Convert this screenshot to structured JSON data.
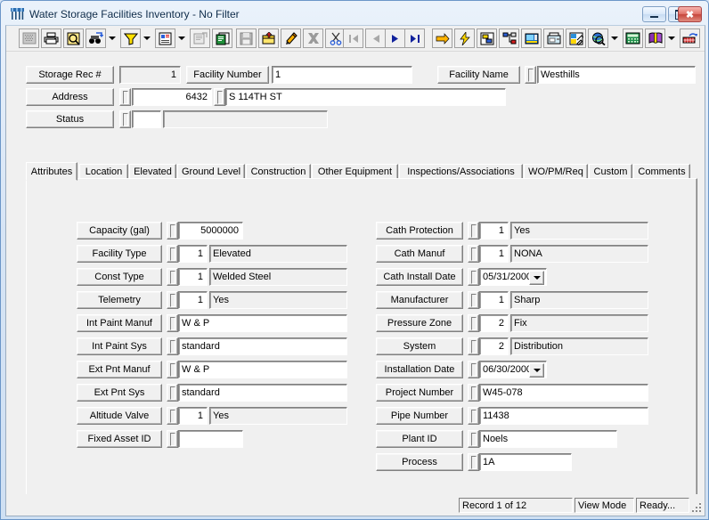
{
  "window": {
    "title": "Water Storage Facilities Inventory - No Filter",
    "icon": "water-tower-icon",
    "minimize_label": "Minimize",
    "maximize_label": "Maximize",
    "close_label": "Close"
  },
  "toolbar": {
    "items": [
      {
        "name": "grid-view-icon",
        "kind": "button",
        "disabled": true
      },
      {
        "name": "print-icon",
        "kind": "button"
      },
      {
        "name": "print-preview-icon",
        "kind": "button"
      },
      {
        "name": "find-icon",
        "kind": "button"
      },
      {
        "name": "find-dropdown-icon",
        "kind": "dropdown"
      },
      {
        "name": "filter-icon",
        "kind": "button"
      },
      {
        "name": "filter-dropdown-icon",
        "kind": "dropdown"
      },
      {
        "name": "report-icon",
        "kind": "button"
      },
      {
        "name": "report-dropdown-icon",
        "kind": "dropdown"
      },
      {
        "name": "properties-icon",
        "kind": "button",
        "disabled": true
      },
      {
        "name": "copy-record-icon",
        "kind": "button"
      },
      {
        "name": "save-icon",
        "kind": "button",
        "disabled": true
      },
      {
        "name": "new-record-icon",
        "kind": "button"
      },
      {
        "name": "edit-record-icon",
        "kind": "button"
      },
      {
        "name": "delete-record-icon",
        "kind": "button",
        "disabled": true
      },
      {
        "name": "cut-icon",
        "kind": "button"
      },
      {
        "name": "first-record-icon",
        "kind": "button",
        "disabled": true
      },
      {
        "name": "previous-record-icon",
        "kind": "button",
        "disabled": true
      },
      {
        "name": "next-record-icon",
        "kind": "button"
      },
      {
        "name": "last-record-icon",
        "kind": "button"
      },
      {
        "name": "goto-icon",
        "kind": "button"
      },
      {
        "name": "quick-action-icon",
        "kind": "button"
      },
      {
        "name": "layout-icon",
        "kind": "button"
      },
      {
        "name": "hierarchy-icon",
        "kind": "button"
      },
      {
        "name": "image-icon",
        "kind": "button"
      },
      {
        "name": "fax-icon",
        "kind": "button"
      },
      {
        "name": "map-icon",
        "kind": "button"
      },
      {
        "name": "globe-search-icon",
        "kind": "button"
      },
      {
        "name": "globe-dropdown-icon",
        "kind": "dropdown"
      },
      {
        "name": "calculator-icon",
        "kind": "button"
      },
      {
        "name": "help-book-icon",
        "kind": "button"
      },
      {
        "name": "help-dropdown-icon",
        "kind": "dropdown"
      },
      {
        "name": "exit-icon",
        "kind": "button"
      }
    ]
  },
  "header": {
    "storage_rec": {
      "label": "Storage Rec #",
      "value": "1"
    },
    "facility_number": {
      "label": "Facility Number",
      "value": "1"
    },
    "facility_name": {
      "label": "Facility Name",
      "value": "Westhills"
    },
    "address": {
      "label": "Address",
      "number": "6432",
      "street": "S 114TH ST"
    },
    "status": {
      "label": "Status",
      "code": "",
      "description": ""
    }
  },
  "tabs": {
    "active": "Attributes",
    "items": [
      {
        "label": "Attributes"
      },
      {
        "label": "Location"
      },
      {
        "label": "Elevated"
      },
      {
        "label": "Ground Level"
      },
      {
        "label": "Construction"
      },
      {
        "label": "Other Equipment"
      },
      {
        "label": "Inspections/Associations"
      },
      {
        "label": "WO/PM/Req"
      },
      {
        "label": "Custom"
      },
      {
        "label": "Comments"
      }
    ]
  },
  "attributes": {
    "left_fields": [
      {
        "label": "Capacity (gal)",
        "code": null,
        "value": "5000000",
        "value_style": "numeric-white"
      },
      {
        "label": "Facility Type",
        "code": "1",
        "value": "Elevated"
      },
      {
        "label": "Const Type",
        "code": "1",
        "value": "Welded Steel"
      },
      {
        "label": "Telemetry",
        "code": "1",
        "value": "Yes"
      },
      {
        "label": "Int Paint Manuf",
        "code": null,
        "value": "W & P",
        "value_style": "wide-white"
      },
      {
        "label": "Int Paint Sys",
        "code": null,
        "value": "standard",
        "value_style": "wide-white"
      },
      {
        "label": "Ext Pnt Manuf",
        "code": null,
        "value": "W & P",
        "value_style": "wide-white"
      },
      {
        "label": "Ext Pnt Sys",
        "code": null,
        "value": "standard",
        "value_style": "wide-white"
      },
      {
        "label": "Altitude Valve",
        "code": "1",
        "value": "Yes"
      },
      {
        "label": "Fixed Asset ID",
        "code": null,
        "value": "",
        "value_style": "short-white"
      }
    ],
    "right_fields": [
      {
        "label": "Cath Protection",
        "code": "1",
        "value": "Yes"
      },
      {
        "label": "Cath Manuf",
        "code": "1",
        "value": "NONA"
      },
      {
        "label": "Cath Install Date",
        "code": null,
        "value": "05/31/2000",
        "value_style": "date-combo"
      },
      {
        "label": "Manufacturer",
        "code": "1",
        "value": "Sharp"
      },
      {
        "label": "Pressure Zone",
        "code": "2",
        "value": "Fix"
      },
      {
        "label": "System",
        "code": "2",
        "value": "Distribution"
      },
      {
        "label": "Installation Date",
        "code": null,
        "value": "06/30/2000",
        "value_style": "date-combo"
      },
      {
        "label": "Project Number",
        "code": null,
        "value": "W45-078",
        "value_style": "wide-white"
      },
      {
        "label": "Pipe Number",
        "code": null,
        "value": "11438",
        "value_style": "wide-white"
      },
      {
        "label": "Plant ID",
        "code": null,
        "value": "Noels",
        "value_style": "med-white"
      },
      {
        "label": "Process",
        "code": null,
        "value": "1A",
        "value_style": "narrow-white"
      }
    ]
  },
  "statusbar": {
    "record": "Record 1 of 12",
    "mode": "View Mode",
    "state": "Ready...",
    "grip": "resize-grip-icon"
  },
  "colors": {
    "face": "#f0f0f0",
    "title_text": "#0b2a49",
    "window_border": "#6b96c8",
    "close_button": "#c6453b"
  }
}
